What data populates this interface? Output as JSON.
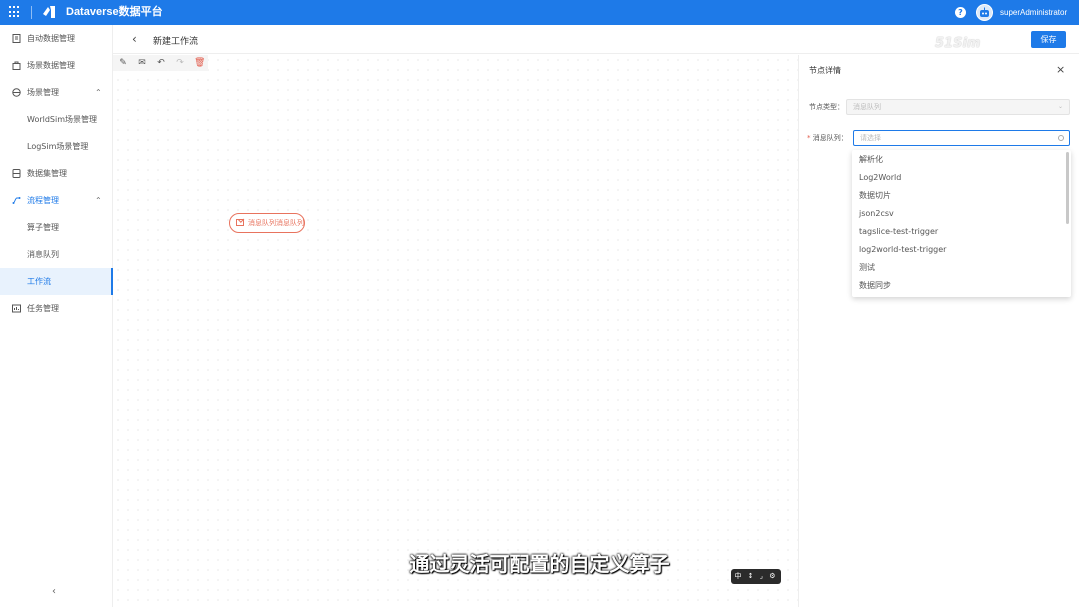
{
  "app": {
    "brand": "Dataverse数据平台",
    "user_name": "superAdministrator",
    "help_glyph": "?",
    "primary_color": "#1e7ae8"
  },
  "sidebar": {
    "items": [
      {
        "label": "自动数据管理",
        "icon": "file-icon",
        "type": "top"
      },
      {
        "label": "场景数据管理",
        "icon": "bag-icon",
        "type": "top"
      },
      {
        "label": "场景管理",
        "icon": "globe-icon",
        "type": "group",
        "expanded": true
      },
      {
        "label": "WorldSim场景管理",
        "type": "sub"
      },
      {
        "label": "LogSim场景管理",
        "type": "sub"
      },
      {
        "label": "数据集管理",
        "icon": "dataset-icon",
        "type": "top"
      },
      {
        "label": "流程管理",
        "icon": "flow-icon",
        "type": "group",
        "expanded": true,
        "active": true
      },
      {
        "label": "算子管理",
        "type": "sub"
      },
      {
        "label": "消息队列",
        "type": "sub"
      },
      {
        "label": "工作流",
        "type": "sub",
        "selected": true
      },
      {
        "label": "任务管理",
        "icon": "task-icon",
        "type": "top"
      }
    ],
    "collapse_glyph": "‹"
  },
  "header": {
    "back_glyph": "‹",
    "title": "新建工作流",
    "save_label": "保存"
  },
  "canvas": {
    "node_label": "消息队列消息队列",
    "zoom_controls": "中 ↕ ⌟ ⚙"
  },
  "panel": {
    "title": "节点详情",
    "close_glyph": "×",
    "node_type_label": "节点类型：",
    "node_type_value": "消息队列",
    "queue_label": "消息队列：",
    "queue_required": "*",
    "queue_placeholder": "请选择",
    "options": [
      "解析化",
      "Log2World",
      "数据切片",
      "json2csv",
      "tagslice-test-trigger",
      "log2world-test-trigger",
      "测试",
      "数据同步"
    ]
  },
  "overlay": {
    "subtitle": "通过灵活可配置的自定义算子",
    "watermark": "51Sim"
  }
}
